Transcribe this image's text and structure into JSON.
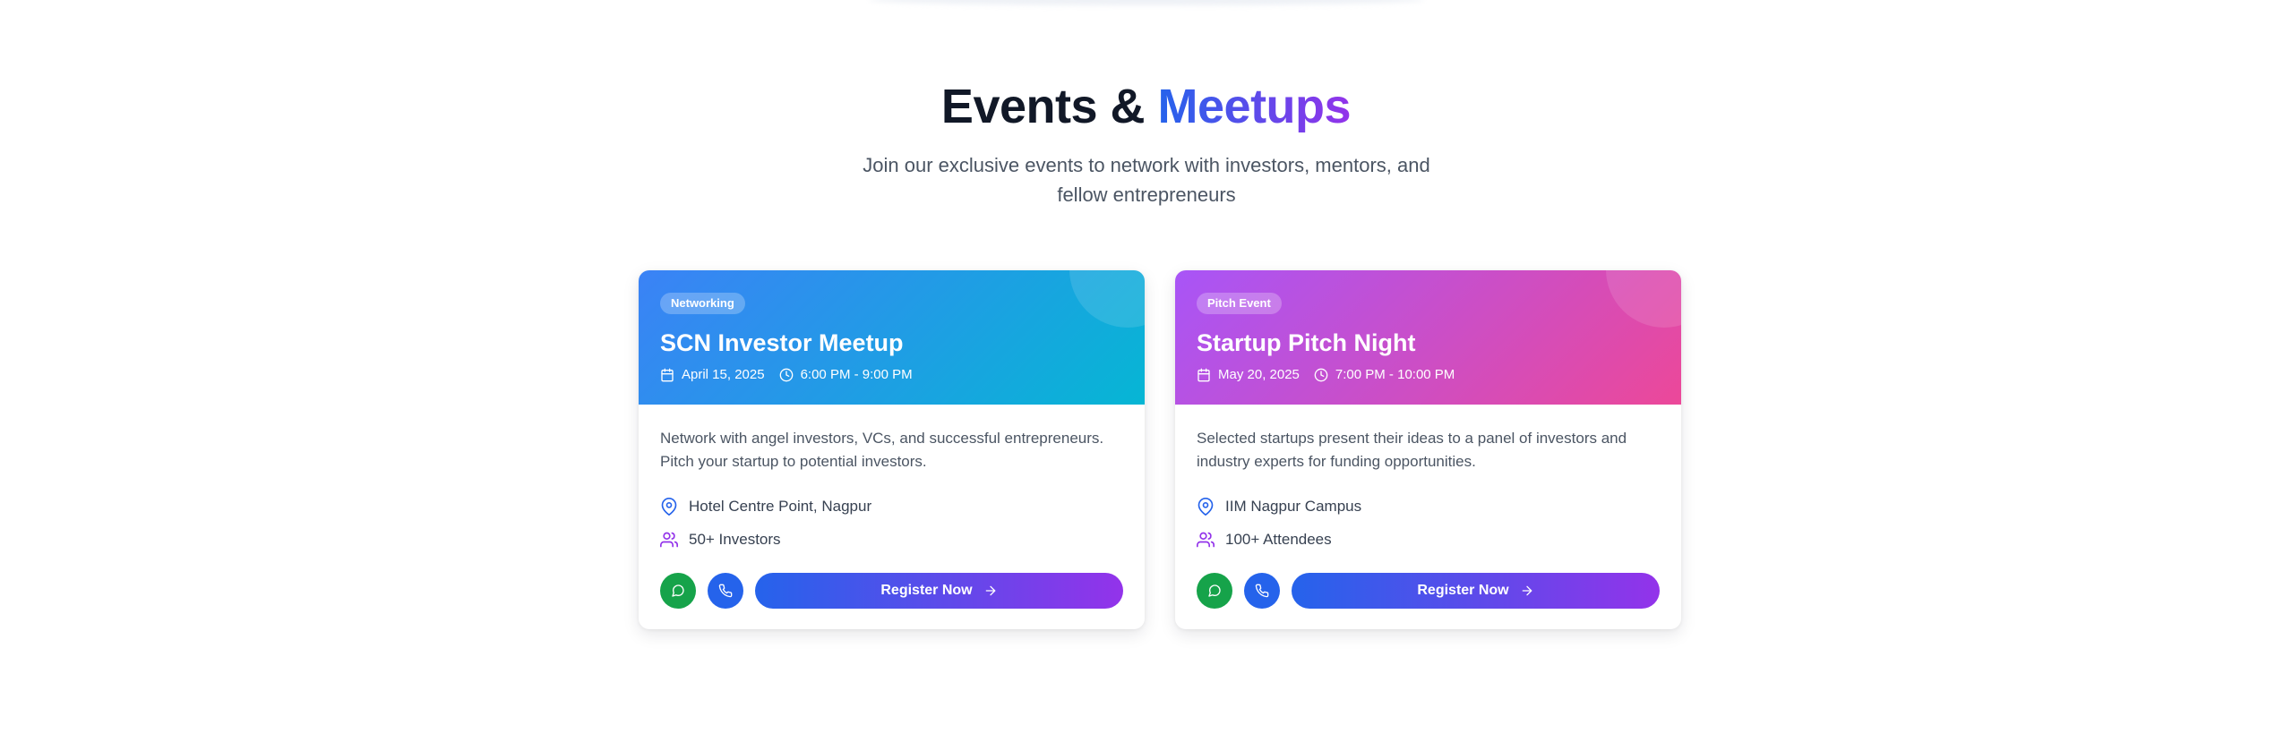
{
  "section": {
    "title_main": "Events & ",
    "title_accent": "Meetups",
    "subtitle": "Join our exclusive events to network with investors, mentors, and fellow entrepreneurs"
  },
  "events": [
    {
      "badge": "Networking",
      "title": "SCN Investor Meetup",
      "date": "April 15, 2025",
      "time": "6:00 PM - 9:00 PM",
      "description": "Network with angel investors, VCs, and successful entrepreneurs. Pitch your startup to potential investors.",
      "location": "Hotel Centre Point, Nagpur",
      "attendees": "50+ Investors",
      "register_label": "Register Now",
      "header_colors": [
        "#3b82f6",
        "#06b6d4"
      ]
    },
    {
      "badge": "Pitch Event",
      "title": "Startup Pitch Night",
      "date": "May 20, 2025",
      "time": "7:00 PM - 10:00 PM",
      "description": "Selected startups present their ideas to a panel of investors and industry experts for funding opportunities.",
      "location": "IIM Nagpur Campus",
      "attendees": "100+ Attendees",
      "register_label": "Register Now",
      "header_colors": [
        "#a855f7",
        "#ec4899"
      ]
    }
  ],
  "icons": {
    "date": "calendar-icon",
    "time": "clock-icon",
    "location": "map-pin-icon",
    "attendees": "users-icon",
    "whatsapp": "message-circle-icon",
    "phone": "phone-icon",
    "register": "arrow-right-icon"
  },
  "colors": {
    "accent_start": "#2563eb",
    "accent_end": "#9333ea",
    "whatsapp_green": "#16a34a",
    "phone_blue": "#2563eb"
  }
}
